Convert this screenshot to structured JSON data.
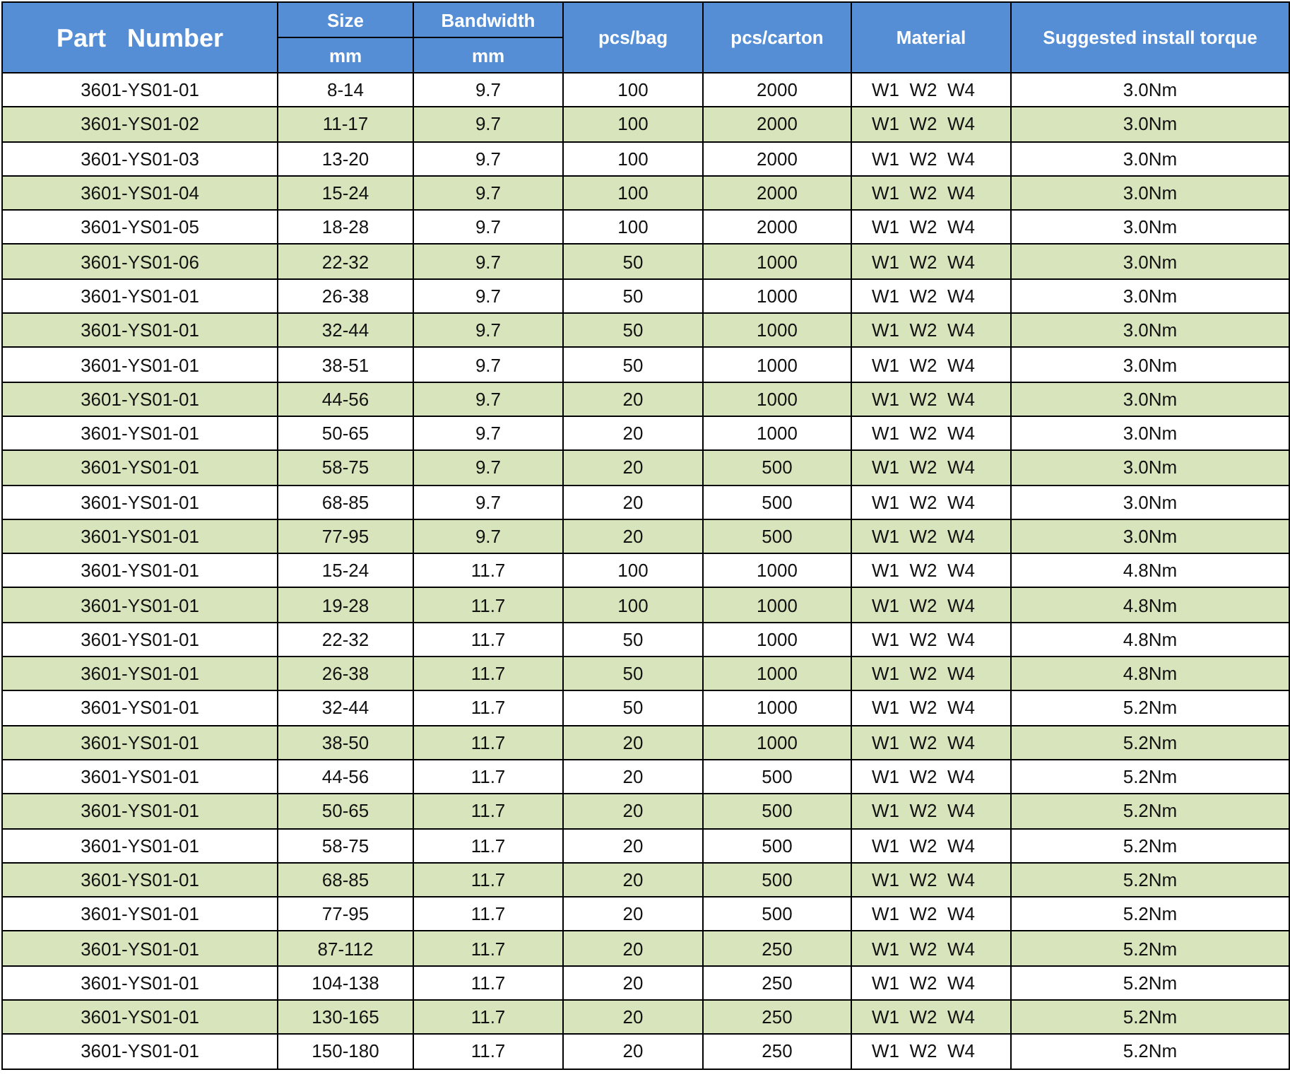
{
  "table": {
    "header": {
      "part_number": "Part   Number",
      "size": "Size",
      "size_unit": "mm",
      "bandwidth": "Bandwidth",
      "bandwidth_unit": "mm",
      "pcs_bag": "pcs/bag",
      "pcs_carton": "pcs/carton",
      "material": "Material",
      "torque": "Suggested install torque"
    },
    "rows": [
      [
        "3601-YS01-01",
        "8-14",
        "9.7",
        "100",
        "2000",
        "W1  W2  W4",
        "3.0Nm"
      ],
      [
        "3601-YS01-02",
        "11-17",
        "9.7",
        "100",
        "2000",
        "W1  W2  W4",
        "3.0Nm"
      ],
      [
        "3601-YS01-03",
        "13-20",
        "9.7",
        "100",
        "2000",
        "W1  W2  W4",
        "3.0Nm"
      ],
      [
        "3601-YS01-04",
        "15-24",
        "9.7",
        "100",
        "2000",
        "W1  W2  W4",
        "3.0Nm"
      ],
      [
        "3601-YS01-05",
        "18-28",
        "9.7",
        "100",
        "2000",
        "W1  W2  W4",
        "3.0Nm"
      ],
      [
        "3601-YS01-06",
        "22-32",
        "9.7",
        "50",
        "1000",
        "W1  W2  W4",
        "3.0Nm"
      ],
      [
        "3601-YS01-01",
        "26-38",
        "9.7",
        "50",
        "1000",
        "W1  W2  W4",
        "3.0Nm"
      ],
      [
        "3601-YS01-01",
        "32-44",
        "9.7",
        "50",
        "1000",
        "W1  W2  W4",
        "3.0Nm"
      ],
      [
        "3601-YS01-01",
        "38-51",
        "9.7",
        "50",
        "1000",
        "W1  W2  W4",
        "3.0Nm"
      ],
      [
        "3601-YS01-01",
        "44-56",
        "9.7",
        "20",
        "1000",
        "W1  W2  W4",
        "3.0Nm"
      ],
      [
        "3601-YS01-01",
        "50-65",
        "9.7",
        "20",
        "1000",
        "W1  W2  W4",
        "3.0Nm"
      ],
      [
        "3601-YS01-01",
        "58-75",
        "9.7",
        "20",
        "500",
        "W1  W2  W4",
        "3.0Nm"
      ],
      [
        "3601-YS01-01",
        "68-85",
        "9.7",
        "20",
        "500",
        "W1  W2  W4",
        "3.0Nm"
      ],
      [
        "3601-YS01-01",
        "77-95",
        "9.7",
        "20",
        "500",
        "W1  W2  W4",
        "3.0Nm"
      ],
      [
        "3601-YS01-01",
        "15-24",
        "11.7",
        "100",
        "1000",
        "W1  W2  W4",
        "4.8Nm"
      ],
      [
        "3601-YS01-01",
        "19-28",
        "11.7",
        "100",
        "1000",
        "W1  W2  W4",
        "4.8Nm"
      ],
      [
        "3601-YS01-01",
        "22-32",
        "11.7",
        "50",
        "1000",
        "W1  W2  W4",
        "4.8Nm"
      ],
      [
        "3601-YS01-01",
        "26-38",
        "11.7",
        "50",
        "1000",
        "W1  W2  W4",
        "4.8Nm"
      ],
      [
        "3601-YS01-01",
        "32-44",
        "11.7",
        "50",
        "1000",
        "W1  W2  W4",
        "5.2Nm"
      ],
      [
        "3601-YS01-01",
        "38-50",
        "11.7",
        "20",
        "1000",
        "W1  W2  W4",
        "5.2Nm"
      ],
      [
        "3601-YS01-01",
        "44-56",
        "11.7",
        "20",
        "500",
        "W1  W2  W4",
        "5.2Nm"
      ],
      [
        "3601-YS01-01",
        "50-65",
        "11.7",
        "20",
        "500",
        "W1  W2  W4",
        "5.2Nm"
      ],
      [
        "3601-YS01-01",
        "58-75",
        "11.7",
        "20",
        "500",
        "W1  W2  W4",
        "5.2Nm"
      ],
      [
        "3601-YS01-01",
        "68-85",
        "11.7",
        "20",
        "500",
        "W1  W2  W4",
        "5.2Nm"
      ],
      [
        "3601-YS01-01",
        "77-95",
        "11.7",
        "20",
        "500",
        "W1  W2  W4",
        "5.2Nm"
      ],
      [
        "3601-YS01-01",
        "87-112",
        "11.7",
        "20",
        "250",
        "W1  W2  W4",
        "5.2Nm"
      ],
      [
        "3601-YS01-01",
        "104-138",
        "11.7",
        "20",
        "250",
        "W1  W2  W4",
        "5.2Nm"
      ],
      [
        "3601-YS01-01",
        "130-165",
        "11.7",
        "20",
        "250",
        "W1  W2  W4",
        "5.2Nm"
      ],
      [
        "3601-YS01-01",
        "150-180",
        "11.7",
        "20",
        "250",
        "W1  W2  W4",
        "5.2Nm"
      ]
    ]
  }
}
